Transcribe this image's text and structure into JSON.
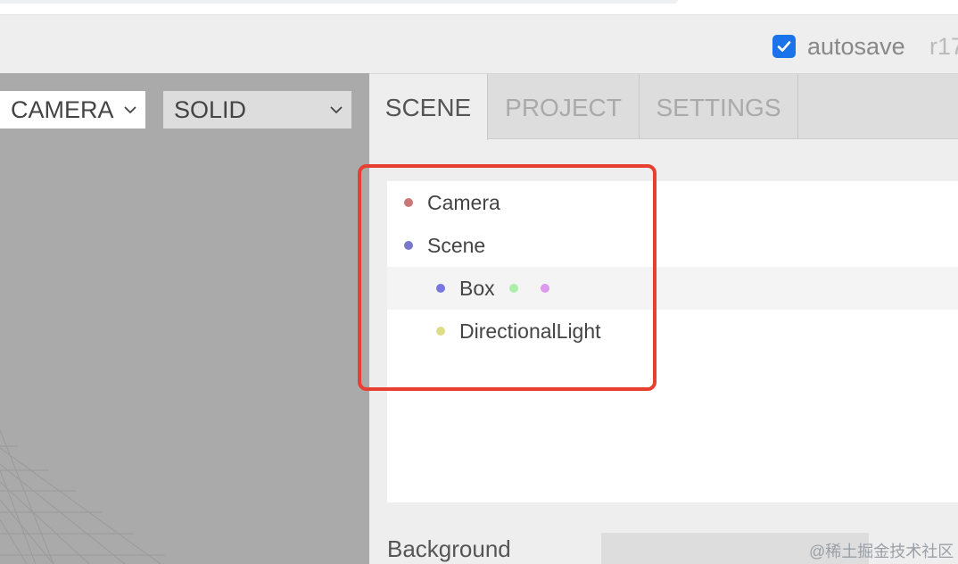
{
  "menubar": {
    "autosave_label": "autosave",
    "autosave_checked": true,
    "revision": "r17"
  },
  "viewport": {
    "camera_select": "CAMERA",
    "shading_select": "SOLID"
  },
  "sidebar": {
    "tabs": [
      {
        "label": "SCENE",
        "active": true
      },
      {
        "label": "PROJECT",
        "active": false
      },
      {
        "label": "SETTINGS",
        "active": false
      }
    ],
    "outliner": [
      {
        "label": "Camera",
        "indent": 0,
        "dot_color": "#cc7777",
        "selected": false,
        "extra_dots": []
      },
      {
        "label": "Scene",
        "indent": 0,
        "dot_color": "#7777cc",
        "selected": false,
        "extra_dots": []
      },
      {
        "label": "Box",
        "indent": 1,
        "dot_color": "#7777dd",
        "selected": true,
        "extra_dots": [
          "#aaeeaa",
          "#dd99ee"
        ]
      },
      {
        "label": "DirectionalLight",
        "indent": 1,
        "dot_color": "#dddd88",
        "selected": false,
        "extra_dots": []
      }
    ],
    "background_label": "Background"
  },
  "highlight_color": "#e84030",
  "watermark": "@稀土掘金技术社区"
}
